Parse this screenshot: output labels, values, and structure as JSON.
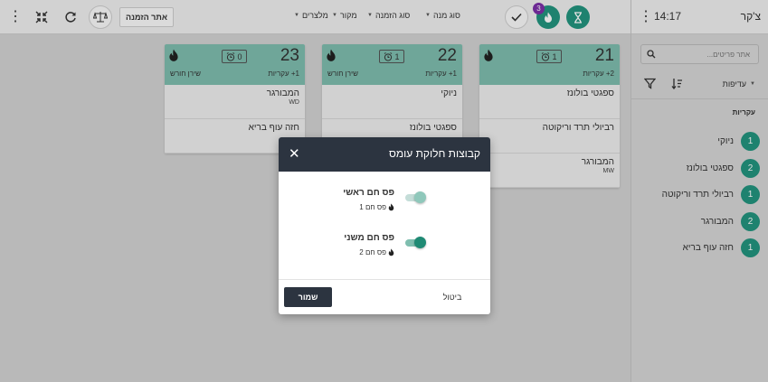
{
  "topbar": {
    "find_order_label": "אתר הזמנה",
    "filters": [
      {
        "label": "מלצרים"
      },
      {
        "label": "מקור"
      },
      {
        "label": "סוג הזמנה"
      },
      {
        "label": "סוג מנה"
      }
    ],
    "badge_count": "3",
    "icons": [
      "kebab-icon",
      "collapse-icon",
      "refresh-icon",
      "scale-icon",
      "check-icon",
      "flame-icon",
      "hourglass-icon",
      "menu-icon"
    ]
  },
  "sidebar": {
    "title": "צ'קר",
    "time": "14:17",
    "search_placeholder": "אתר פריטים...",
    "priority_label": "עדיפות",
    "section_label": "עקריות",
    "items": [
      {
        "count": "1",
        "name": "ניוקי"
      },
      {
        "count": "2",
        "name": "ספגטי בולונז"
      },
      {
        "count": "1",
        "name": "רביולי תרד וריקוטה"
      },
      {
        "count": "2",
        "name": "המבורגר"
      },
      {
        "count": "1",
        "name": "חזה עוף בריא"
      }
    ]
  },
  "cards": [
    {
      "number": "21",
      "subtitle": "2+ עקריות",
      "service": "",
      "timer": "1",
      "items": [
        {
          "name": "ספגטי בולונז",
          "mod": ""
        },
        {
          "name": "רביולי תרד וריקוטה",
          "mod": ""
        },
        {
          "name": "המבורגר",
          "mod": "MW"
        }
      ]
    },
    {
      "number": "22",
      "subtitle": "1+ עקריות",
      "service": "שירן חורש",
      "timer": "1",
      "items": [
        {
          "name": "ניוקי",
          "mod": ""
        },
        {
          "name": "ספגטי בולונז",
          "mod": ""
        }
      ]
    },
    {
      "number": "23",
      "subtitle": "1+ עקריות",
      "service": "שירן חורש",
      "timer": "0",
      "items": [
        {
          "name": "המבורגר",
          "mod": "WD"
        },
        {
          "name": "חזה עוף בריא",
          "mod": ""
        }
      ]
    }
  ],
  "modal": {
    "title": "קבוצות חלוקת עומס",
    "rows": [
      {
        "title": "פס חם ראשי",
        "sub": "פס חם 1",
        "enabled": false
      },
      {
        "title": "פס חם משני",
        "sub": "פס חם 2",
        "enabled": true
      }
    ],
    "save_label": "שמור",
    "cancel_label": "ביטול"
  },
  "colors": {
    "accent": "#23947f",
    "card_header": "#7fbeaf",
    "modal_header": "#2c3440",
    "badge": "#7b2fa8"
  }
}
